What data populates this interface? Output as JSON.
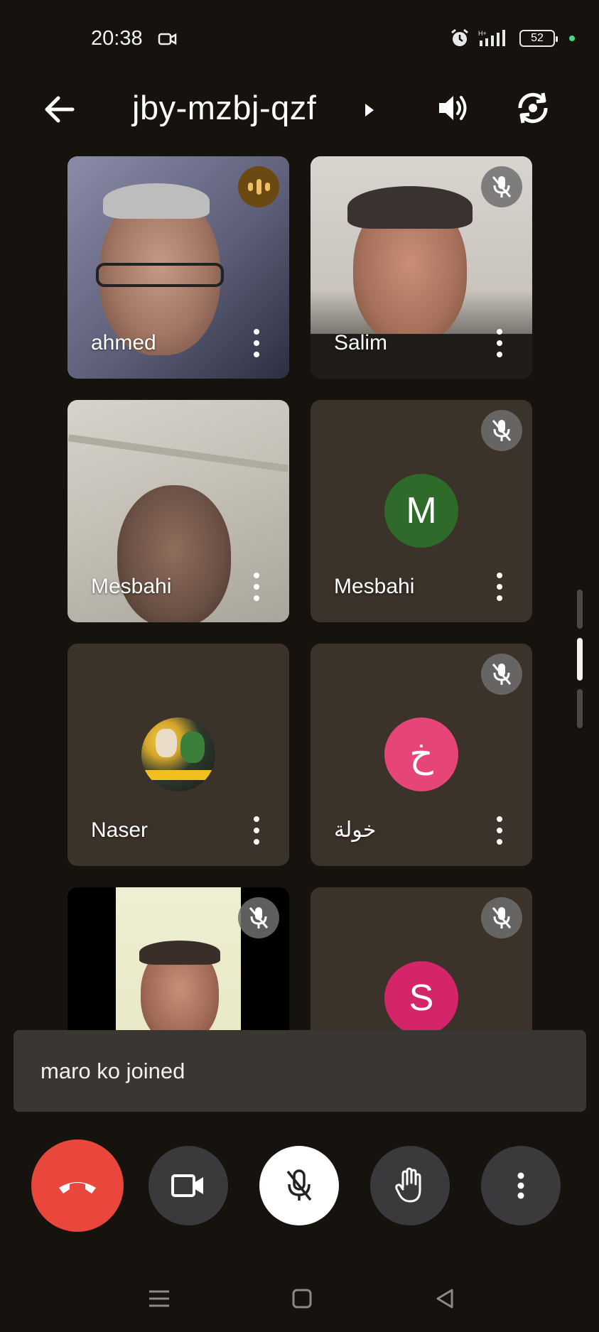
{
  "status_bar": {
    "time": "20:38",
    "battery": "52",
    "icons": [
      "screen-record-icon",
      "alarm-icon",
      "signal-icon",
      "battery-icon"
    ]
  },
  "top_bar": {
    "meeting_code": "jby-mzbj-qzf",
    "icons": [
      "back-arrow-icon",
      "caret-right-icon",
      "speaker-icon",
      "switch-camera-icon"
    ]
  },
  "participants": [
    {
      "name": "ahmed",
      "status": "speaking"
    },
    {
      "name": "Salim",
      "status": "muted"
    },
    {
      "name": "Mesbahi",
      "status": "video"
    },
    {
      "name": "Mesbahi",
      "status": "muted",
      "avatar_letter": "M",
      "avatar_color": "#2e6b2a"
    },
    {
      "name": "Naser",
      "status": "avatar-image"
    },
    {
      "name": "خولة",
      "status": "muted",
      "avatar_letter": "خ",
      "avatar_color": "#e64577"
    },
    {
      "name": "",
      "status": "muted"
    },
    {
      "name": "",
      "status": "muted",
      "avatar_letter": "S",
      "avatar_color": "#d4246a"
    }
  ],
  "toast": {
    "text": "maro ko joined"
  },
  "controls": {
    "items": [
      "end-call",
      "camera",
      "microphone-muted",
      "raise-hand",
      "more-options"
    ],
    "colors": {
      "end_call": "#e9473c",
      "button": "#3a3a3c",
      "active": "#ffffff"
    }
  },
  "nav_bar": {
    "items": [
      "menu",
      "home",
      "back"
    ]
  }
}
